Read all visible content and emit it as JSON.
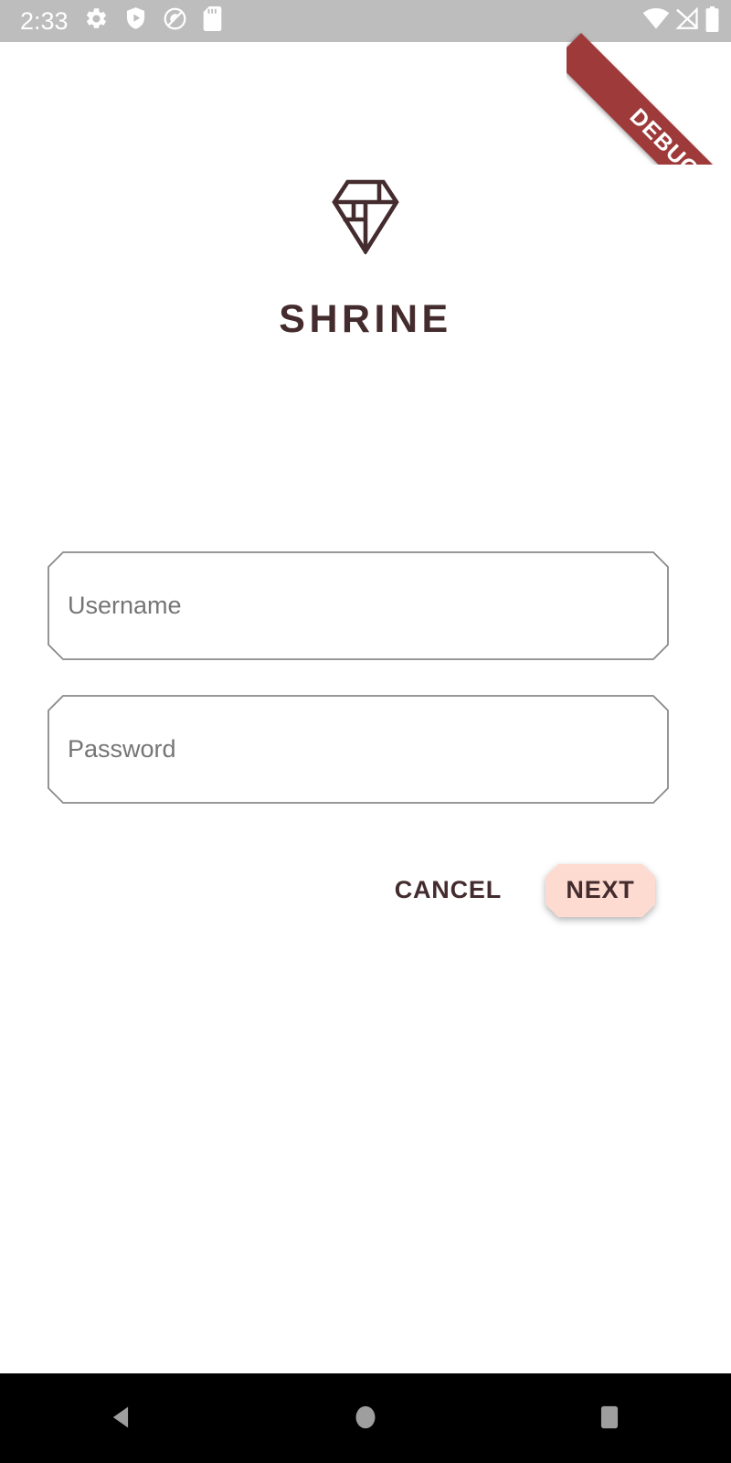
{
  "status_bar": {
    "clock": "2:33",
    "background": "#bdbdbd",
    "foreground": "#ffffff",
    "left_icons": [
      {
        "name": "settings-gear-icon",
        "label": "Settings"
      },
      {
        "name": "shield-play-icon",
        "label": "Play Protect"
      },
      {
        "name": "do-not-disturb-icon",
        "label": "Do Not Disturb"
      },
      {
        "name": "sd-card-icon",
        "label": "SD Card"
      }
    ],
    "right_icons": [
      {
        "name": "wifi-icon",
        "label": "Wi-Fi"
      },
      {
        "name": "cellular-signal-off-icon",
        "label": "No Signal"
      },
      {
        "name": "battery-icon",
        "label": "Battery"
      }
    ]
  },
  "debug_banner": {
    "label": "DEBUG",
    "color": "#9e3a3a"
  },
  "branding": {
    "logo_name": "shrine-diamond-logo",
    "title": "SHRINE",
    "color": "#442c2e"
  },
  "form": {
    "fields": [
      {
        "name": "username-input",
        "placeholder": "Username",
        "value": "",
        "type": "text"
      },
      {
        "name": "password-input",
        "placeholder": "Password",
        "value": "",
        "type": "password"
      }
    ],
    "border_color": "#8a8a8a",
    "placeholder_color": "#757575"
  },
  "actions": {
    "cancel_label": "CANCEL",
    "next_label": "NEXT",
    "next_background": "#fedbd0",
    "text_color": "#442c2e"
  },
  "nav_bar": {
    "background": "#000000",
    "icon_color": "#9e9e9e",
    "buttons": [
      {
        "name": "nav-back-button",
        "label": "Back"
      },
      {
        "name": "nav-home-button",
        "label": "Home"
      },
      {
        "name": "nav-recents-button",
        "label": "Recents"
      }
    ]
  }
}
